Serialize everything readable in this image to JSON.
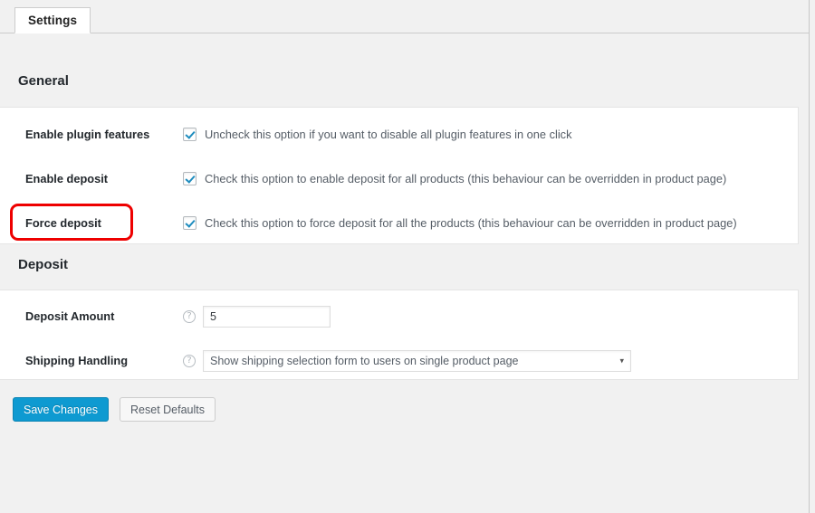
{
  "tabs": [
    {
      "label": "Settings",
      "active": true
    }
  ],
  "sections": [
    {
      "id": "general",
      "title": "General",
      "rows": [
        {
          "label": "Enable plugin features",
          "type": "checkbox",
          "checked": true,
          "description": "Uncheck this option if you want to disable all plugin features in one click"
        },
        {
          "label": "Enable deposit",
          "type": "checkbox",
          "checked": true,
          "description": "Check this option to enable deposit for all products (this behaviour can be overridden in product page)"
        },
        {
          "label": "Force deposit",
          "type": "checkbox",
          "checked": true,
          "description": "Check this option to force deposit for all the products (this behaviour can be overridden in product page)",
          "highlighted": true
        }
      ]
    },
    {
      "id": "deposit",
      "title": "Deposit",
      "rows": [
        {
          "label": "Deposit Amount",
          "type": "text",
          "help_icon": "question-mark-icon",
          "value": "5",
          "placeholder": ""
        },
        {
          "label": "Shipping Handling",
          "type": "select",
          "help_icon": "question-mark-icon",
          "value": "Show shipping selection form to users on single product page",
          "arrow": "▾"
        }
      ]
    }
  ],
  "buttons": {
    "save": "Save Changes",
    "reset": "Reset Defaults"
  },
  "colors": {
    "page_background": "#f1f1f1",
    "panel_background": "#ffffff",
    "accent_blue": "#0e9ad1",
    "checkbox_check": "#1e8cbe",
    "annotation_red": "#ee0000",
    "border_gray": "#e5e5e5",
    "label_text": "#23282d",
    "body_text": "#555d66"
  },
  "annotation": {
    "target": "Force deposit",
    "shape": "rounded-rectangle",
    "color": "#ee0000"
  }
}
